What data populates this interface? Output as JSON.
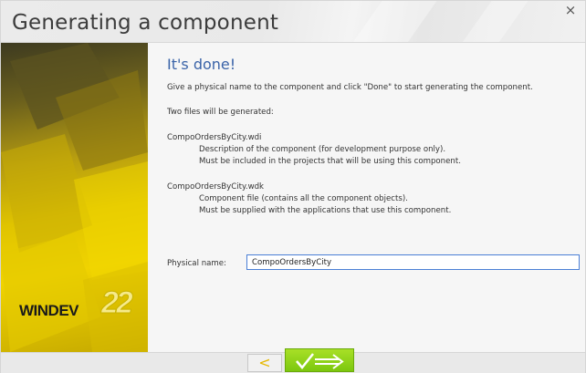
{
  "window": {
    "title": "Generating a component",
    "close_label": "×"
  },
  "brand": {
    "logo_text": "WINDEV",
    "version": "22"
  },
  "content": {
    "heading": "It's done!",
    "instruction": "Give a physical name to the component and click \"Done\" to start generating the component.",
    "files_intro": "Two files will be generated:",
    "files": [
      {
        "name": "CompoOrdersByCity.wdi",
        "desc1": "Description of the component (for development purpose only).",
        "desc2": "Must be included in the projects that will be using this component."
      },
      {
        "name": "CompoOrdersByCity.wdk",
        "desc1": "Component file (contains all the component objects).",
        "desc2": "Must be supplied with the applications that use this component."
      }
    ]
  },
  "form": {
    "physical_name_label": "Physical name:",
    "physical_name_value": "CompoOrdersByCity"
  },
  "buttons": {
    "back_label": "<"
  },
  "colors": {
    "heading": "#3a63a8",
    "done_button": "#8fd31a",
    "back_arrow": "#e6b800",
    "input_border": "#4a7fd6"
  }
}
